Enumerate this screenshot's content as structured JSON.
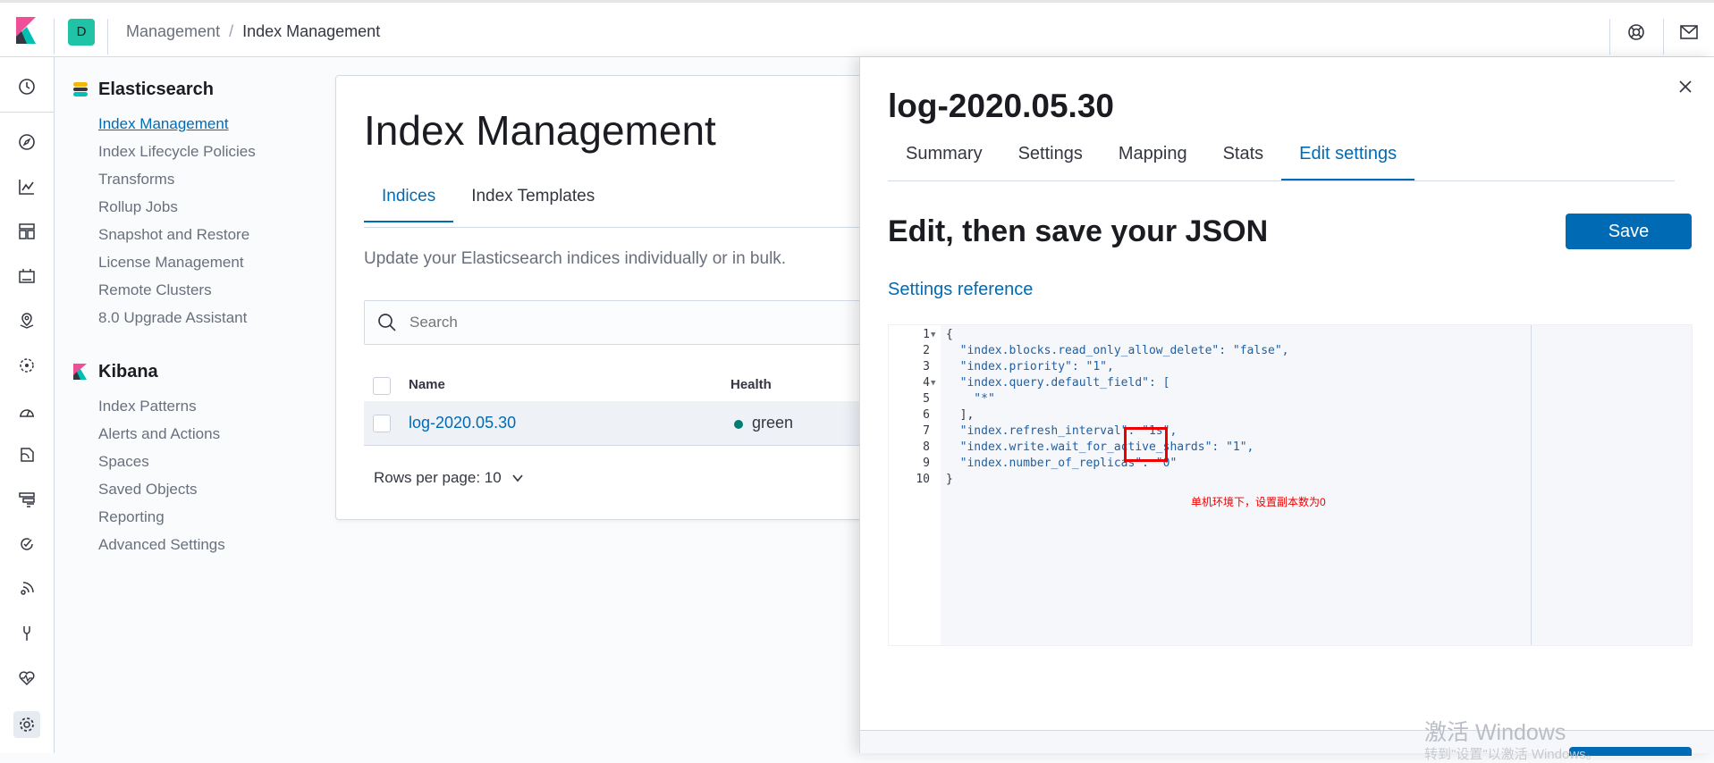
{
  "topbar": {
    "space_initial": "D",
    "breadcrumbs": [
      "Management",
      "Index Management"
    ]
  },
  "sidebar": {
    "groups": [
      {
        "title": "Elasticsearch",
        "items": [
          "Index Management",
          "Index Lifecycle Policies",
          "Transforms",
          "Rollup Jobs",
          "Snapshot and Restore",
          "License Management",
          "Remote Clusters",
          "8.0 Upgrade Assistant"
        ],
        "active_index": 0
      },
      {
        "title": "Kibana",
        "items": [
          "Index Patterns",
          "Alerts and Actions",
          "Spaces",
          "Saved Objects",
          "Reporting",
          "Advanced Settings"
        ]
      }
    ]
  },
  "main": {
    "title": "Index Management",
    "tabs": [
      "Indices",
      "Index Templates"
    ],
    "active_tab": 0,
    "description": "Update your Elasticsearch indices individually or in bulk.",
    "search_placeholder": "Search",
    "columns": [
      "Name",
      "Health"
    ],
    "rows": [
      {
        "name": "log-2020.05.30",
        "health": "green"
      }
    ],
    "rows_per_page": "Rows per page: 10"
  },
  "flyout": {
    "title": "log-2020.05.30",
    "tabs": [
      "Summary",
      "Settings",
      "Mapping",
      "Stats",
      "Edit settings"
    ],
    "active_tab": 4,
    "heading": "Edit, then save your JSON",
    "save_label": "Save",
    "settings_reference": "Settings reference",
    "code": [
      "{",
      "  \"index.blocks.read_only_allow_delete\": \"false\",",
      "  \"index.priority\": \"1\",",
      "  \"index.query.default_field\": [",
      "    \"*\"",
      "  ],",
      "  \"index.refresh_interval\": \"1s\",",
      "  \"index.write.wait_for_active_shards\": \"1\",",
      "  \"index.number_of_replicas\": \"0\"",
      "}"
    ],
    "annotation": "单机环境下，设置副本数为0"
  },
  "watermark": {
    "line1": "激活 Windows",
    "line2": "转到\"设置\"以激活 Windows。"
  },
  "colors": {
    "primary": "#006bb4",
    "health_green": "#017d73",
    "annotation_red": "#e00000",
    "space_avatar": "#20c3a6"
  }
}
